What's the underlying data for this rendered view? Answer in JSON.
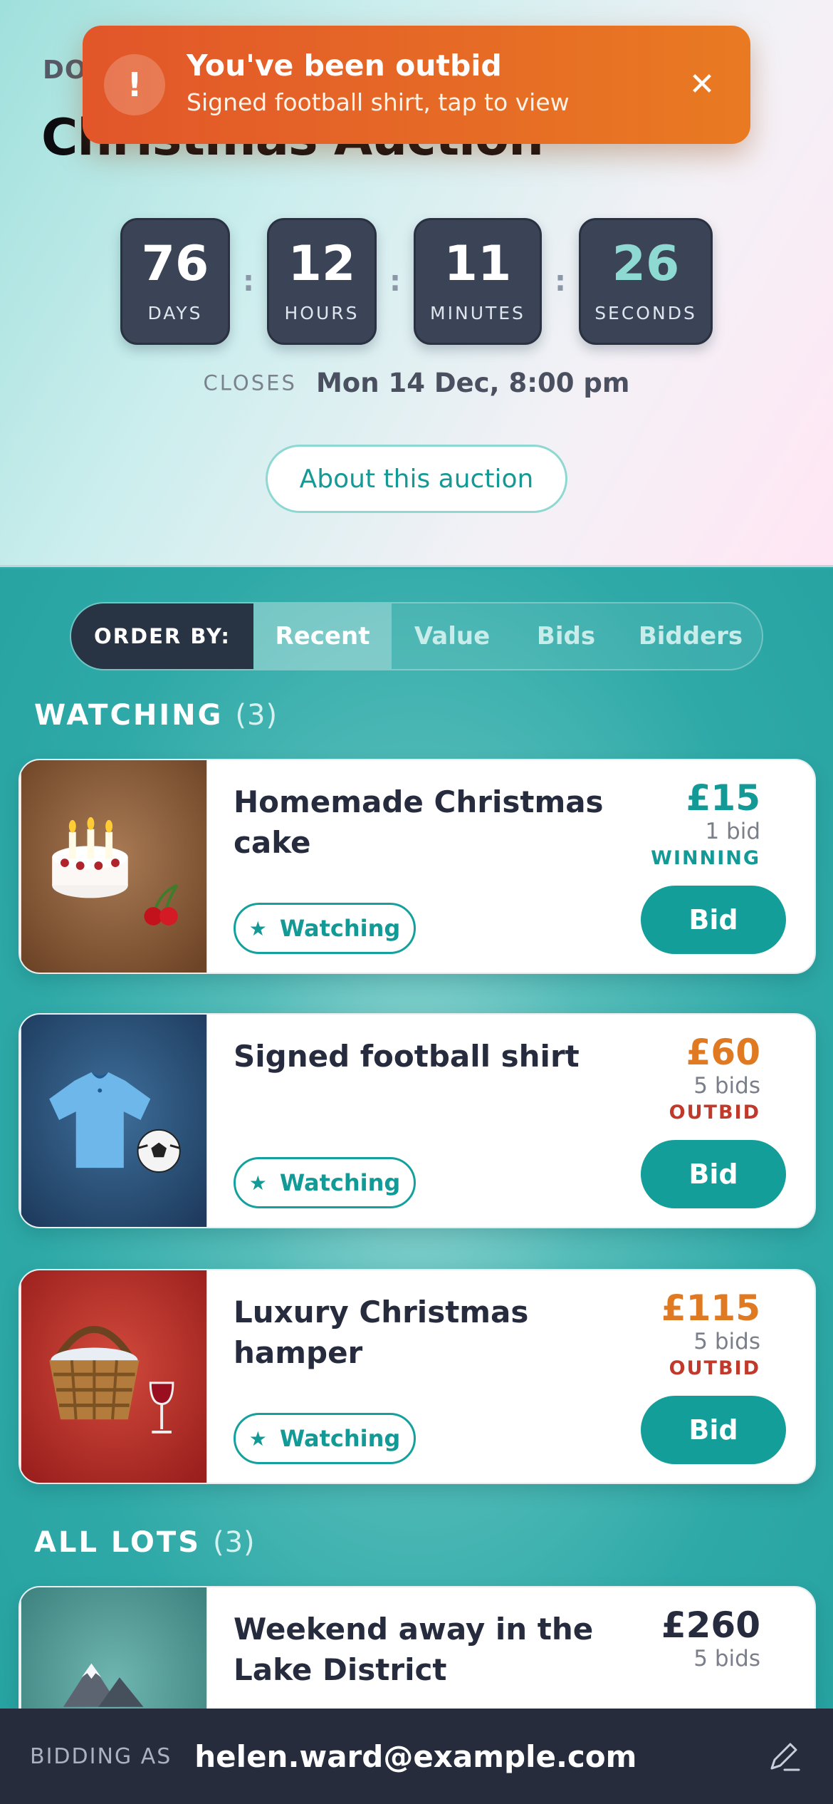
{
  "header": {
    "kicker": "DO",
    "title": "Christmas Auction",
    "countdown": [
      {
        "value": "76",
        "unit": "DAYS"
      },
      {
        "value": "12",
        "unit": "HOURS"
      },
      {
        "value": "11",
        "unit": "MINUTES"
      },
      {
        "value": "26",
        "unit": "SECONDS"
      }
    ],
    "closes_label": "CLOSES",
    "closes_value": "Mon 14 Dec, 8:00 pm",
    "about_label": "About this auction"
  },
  "toast": {
    "icon": "!",
    "title": "You've been outbid",
    "subtitle": "Signed football shirt, tap to view",
    "close_icon": "✕"
  },
  "sort": {
    "label": "ORDER BY:",
    "options": [
      "Recent",
      "Value",
      "Bids",
      "Bidders"
    ],
    "active": "Recent"
  },
  "sections": {
    "watching_title": "WATCHING",
    "watching_count": "(3)",
    "all_title": "ALL LOTS",
    "all_count": "(3)"
  },
  "lots": [
    {
      "title": "Homemade Christmas cake",
      "price": "£15",
      "bids": "1 bid",
      "status": "WINNING",
      "watch_label": "Watching",
      "bid_label": "Bid",
      "image_icon": "cake-icon"
    },
    {
      "title": "Signed football shirt",
      "price": "£60",
      "bids": "5 bids",
      "status": "OUTBID",
      "watch_label": "Watching",
      "bid_label": "Bid",
      "image_icon": "shirt-icon"
    },
    {
      "title": "Luxury Christmas hamper",
      "price": "£115",
      "bids": "5 bids",
      "status": "OUTBID",
      "watch_label": "Watching",
      "bid_label": "Bid",
      "image_icon": "hamper-icon"
    },
    {
      "title": "Weekend away in the Lake District",
      "price": "£260",
      "bids": "5 bids",
      "status": "",
      "watch_label": "",
      "bid_label": "",
      "image_icon": "mountain-icon"
    }
  ],
  "footer": {
    "label": "BIDDING AS",
    "user": "helen.ward@example.com"
  },
  "colors": {
    "accent": "#149e9a",
    "outbid": "#c0392b",
    "winning_price": "#149a96",
    "outbid_price": "#e07a22",
    "toast": "#e2562a",
    "dark": "#262c3c"
  }
}
